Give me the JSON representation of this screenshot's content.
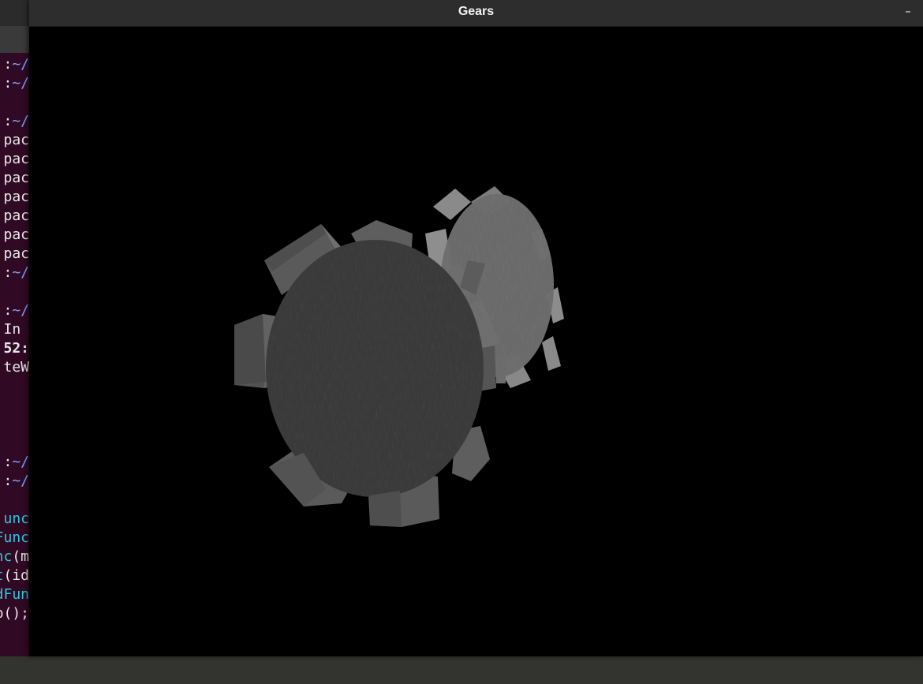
{
  "window": {
    "title": "Gears",
    "minimize_label": "–"
  },
  "terminal": {
    "lines": [
      {
        "segments": [
          {
            "text": ":",
            "color": "#e8e8e8"
          },
          {
            "text": "~/",
            "color": "#7ea3ff"
          }
        ]
      },
      {
        "segments": [
          {
            "text": ":",
            "color": "#e8e8e8"
          },
          {
            "text": "~/",
            "color": "#7ea3ff"
          }
        ]
      },
      {
        "segments": []
      },
      {
        "segments": [
          {
            "text": ":",
            "color": "#e8e8e8"
          },
          {
            "text": "~/",
            "color": "#7ea3ff"
          }
        ]
      },
      {
        "segments": [
          {
            "text": "pac",
            "color": "#e8e8e8"
          }
        ]
      },
      {
        "segments": [
          {
            "text": "pac",
            "color": "#e8e8e8"
          }
        ]
      },
      {
        "segments": [
          {
            "text": "pac",
            "color": "#e8e8e8"
          }
        ]
      },
      {
        "segments": [
          {
            "text": "pac",
            "color": "#e8e8e8"
          }
        ]
      },
      {
        "segments": [
          {
            "text": "pac",
            "color": "#e8e8e8"
          }
        ]
      },
      {
        "segments": [
          {
            "text": "pac",
            "color": "#e8e8e8"
          }
        ]
      },
      {
        "segments": [
          {
            "text": "pac",
            "color": "#e8e8e8"
          }
        ]
      },
      {
        "segments": [
          {
            "text": ":",
            "color": "#e8e8e8"
          },
          {
            "text": "~/",
            "color": "#7ea3ff"
          }
        ]
      },
      {
        "segments": []
      },
      {
        "segments": [
          {
            "text": ":",
            "color": "#e8e8e8"
          },
          {
            "text": "~/",
            "color": "#7ea3ff"
          }
        ]
      },
      {
        "segments": [
          {
            "text": " In ",
            "color": "#e8e8e8"
          }
        ]
      },
      {
        "segments": [
          {
            "text": "52:",
            "color": "#e8e8e8",
            "bold": true
          }
        ]
      },
      {
        "segments": [
          {
            "text": "teW",
            "color": "#e8e8e8"
          }
        ]
      },
      {
        "segments": []
      },
      {
        "segments": []
      },
      {
        "segments": []
      },
      {
        "segments": []
      },
      {
        "segments": [
          {
            "text": ":",
            "color": "#e8e8e8"
          },
          {
            "text": "~/",
            "color": "#7ea3ff"
          }
        ]
      },
      {
        "segments": [
          {
            "text": ":",
            "color": "#e8e8e8"
          },
          {
            "text": "~/",
            "color": "#7ea3ff"
          }
        ]
      },
      {
        "segments": []
      },
      {
        "segments": [
          {
            "text": "unc",
            "color": "#33c7de"
          }
        ]
      },
      {
        "segments": [
          {
            "text": "Func",
            "color": "#33c7de"
          }
        ]
      },
      {
        "segments": [
          {
            "text": "nc",
            "color": "#33c7de"
          },
          {
            "text": "(m",
            "color": "#e8e8e8"
          }
        ]
      },
      {
        "segments": [
          {
            "text": "t",
            "color": "#33c7de"
          },
          {
            "text": "(id",
            "color": "#e8e8e8"
          }
        ]
      },
      {
        "segments": [
          {
            "text": "dFun",
            "color": "#33c7de"
          }
        ]
      },
      {
        "segments": [
          {
            "text": "p();",
            "color": "#e8e8e8"
          }
        ]
      }
    ],
    "background": "#300a24"
  },
  "colors": {
    "gear_large_face": "#3a3a3a",
    "gear_large_tooth": "#5a5a5a",
    "gear_large_tooth_side": "#6e6e6e",
    "gear_small_face": "#6a6a6a",
    "gear_small_tooth": "#808080",
    "gear_small_tooth_side": "#9a9a9a"
  }
}
